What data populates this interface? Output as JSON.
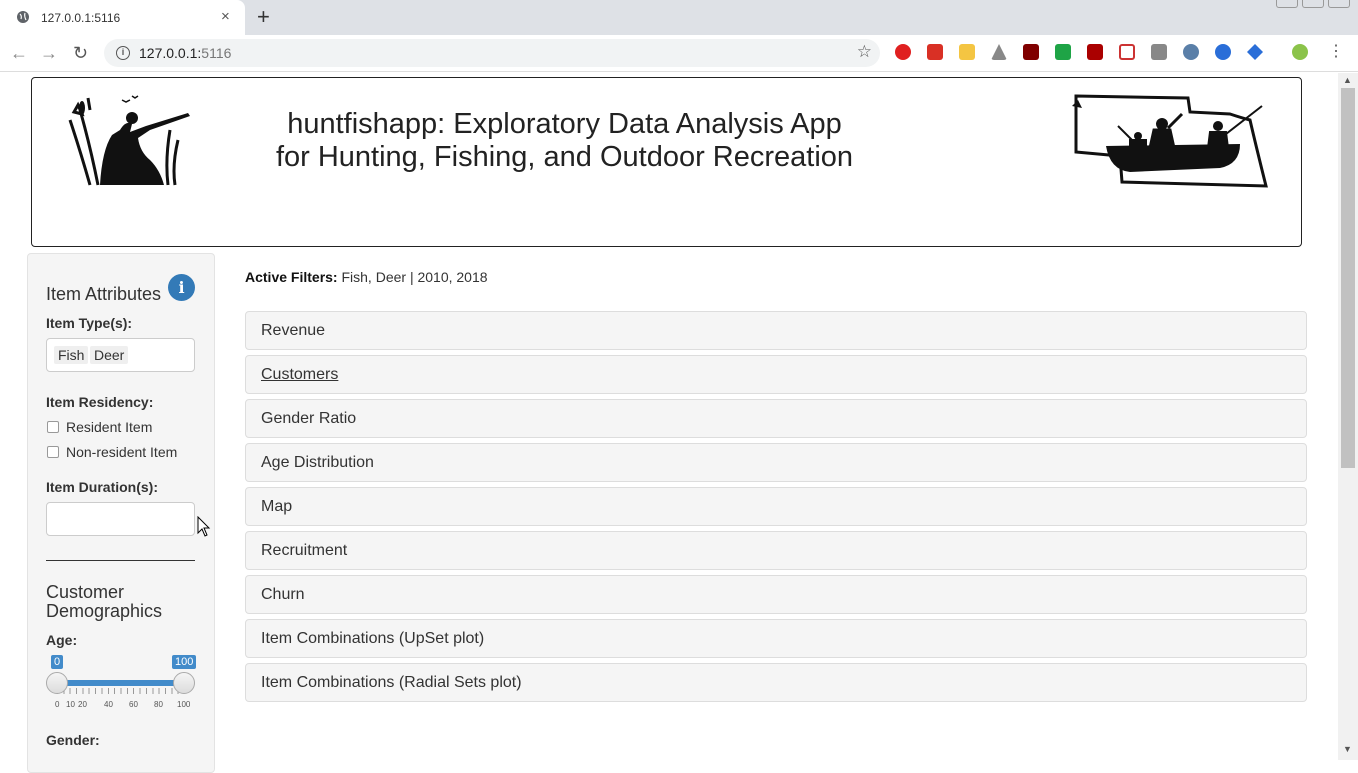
{
  "browser": {
    "tab_title": "127.0.0.1:5116",
    "url_host": "127.0.0.1:",
    "url_port": "5116",
    "new_tab_symbol": "+",
    "close_symbol": "×"
  },
  "banner": {
    "title": "huntfishapp: Exploratory Data Analysis App for Hunting, Fishing, and Outdoor Recreation"
  },
  "sidebar": {
    "item_attributes_heading": "Item Attributes",
    "item_types_label": "Item Type(s):",
    "item_types_selected": [
      "Fish",
      "Deer"
    ],
    "item_residency_label": "Item Residency:",
    "residency_options": [
      "Resident Item",
      "Non-resident Item"
    ],
    "item_duration_label": "Item Duration(s):",
    "item_duration_value": "",
    "customer_demographics_heading": "Customer Demographics",
    "age_label": "Age:",
    "age_min": "0",
    "age_max": "100",
    "age_tick_labels": [
      "0",
      "10",
      "20",
      "40",
      "60",
      "80",
      "100"
    ],
    "gender_label": "Gender:"
  },
  "main": {
    "active_filters_label": "Active Filters:",
    "active_filters_value": "Fish, Deer | 2010, 2018",
    "panels": [
      "Revenue",
      "Customers",
      "Gender Ratio",
      "Age Distribution",
      "Map",
      "Recruitment",
      "Churn",
      "Item Combinations (UpSet plot)",
      "Item Combinations (Radial Sets plot)"
    ]
  },
  "colors": {
    "accent": "#337ab7",
    "slider": "#428bca",
    "panel_bg": "#f5f5f5"
  }
}
